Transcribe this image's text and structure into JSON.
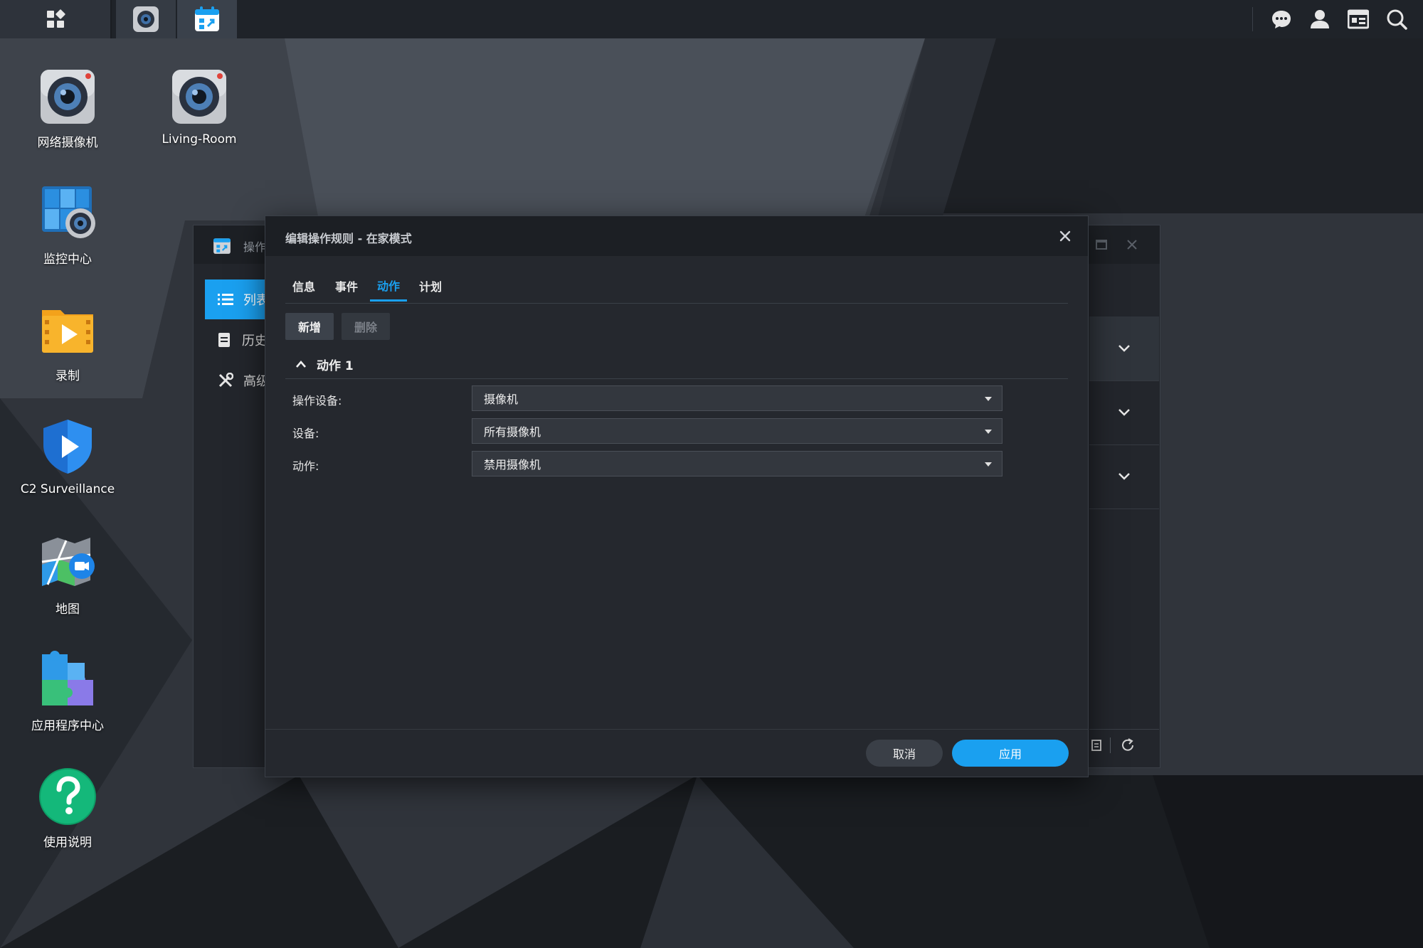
{
  "desktop": {
    "icons": [
      {
        "label": "网络摄像机"
      },
      {
        "label": "Living-Room"
      },
      {
        "label": "监控中心"
      },
      {
        "label": "录制"
      },
      {
        "label": "C2 Surveillance"
      },
      {
        "label": "地图"
      },
      {
        "label": "应用程序中心"
      },
      {
        "label": "使用说明"
      }
    ]
  },
  "background_window": {
    "title": "操作",
    "sidebar": [
      {
        "label": "列表"
      },
      {
        "label": "历史"
      },
      {
        "label": "高级"
      }
    ]
  },
  "dialog": {
    "title": "编辑操作规则 - 在家模式",
    "tabs": [
      {
        "label": "信息"
      },
      {
        "label": "事件"
      },
      {
        "label": "动作",
        "active": true
      },
      {
        "label": "计划"
      }
    ],
    "toolbar": {
      "add_label": "新增",
      "delete_label": "删除"
    },
    "section": {
      "title": "动作 1"
    },
    "fields": [
      {
        "label": "操作设备:",
        "value": "摄像机"
      },
      {
        "label": "设备:",
        "value": "所有摄像机"
      },
      {
        "label": "动作:",
        "value": "禁用摄像机"
      }
    ],
    "footer": {
      "cancel_label": "取消",
      "apply_label": "应用"
    }
  },
  "colors": {
    "accent": "#1aa0f0",
    "taskbar": "#1f2329",
    "dialog_bg": "#25282e"
  }
}
